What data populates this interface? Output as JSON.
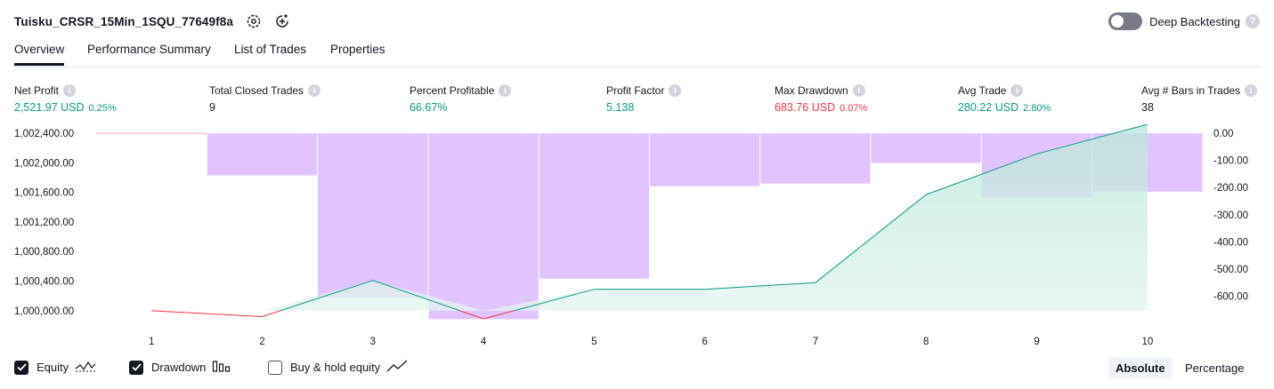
{
  "header": {
    "strategy_title": "Tuisku_CRSR_15Min_1SQU_77649f8a",
    "deep_backtesting_label": "Deep Backtesting"
  },
  "tabs": [
    {
      "label": "Overview",
      "active": true
    },
    {
      "label": "Performance Summary",
      "active": false
    },
    {
      "label": "List of Trades",
      "active": false
    },
    {
      "label": "Properties",
      "active": false
    }
  ],
  "metrics": [
    {
      "label": "Net Profit",
      "value": "2,521.97 USD",
      "sub": "0.25%",
      "color": "#089981"
    },
    {
      "label": "Total Closed Trades",
      "value": "9",
      "sub": "",
      "color": "#131722"
    },
    {
      "label": "Percent Profitable",
      "value": "66.67%",
      "sub": "",
      "color": "#089981"
    },
    {
      "label": "Profit Factor",
      "value": "5.138",
      "sub": "",
      "color": "#089981"
    },
    {
      "label": "Max Drawdown",
      "value": "683.76 USD",
      "sub": "0.07%",
      "color": "#f23645"
    },
    {
      "label": "Avg Trade",
      "value": "280.22 USD",
      "sub": "2.80%",
      "color": "#089981"
    },
    {
      "label": "Avg # Bars in Trades",
      "value": "38",
      "sub": "",
      "color": "#131722"
    }
  ],
  "legend": {
    "equity": {
      "label": "Equity",
      "checked": true
    },
    "drawdown": {
      "label": "Drawdown",
      "checked": true
    },
    "buy_hold": {
      "label": "Buy & hold equity",
      "checked": false
    }
  },
  "modes": {
    "absolute": "Absolute",
    "percentage": "Percentage",
    "active": "absolute"
  },
  "colors": {
    "profit": "#089981",
    "loss": "#f23645",
    "drawdown_bar": "#e1c4fd",
    "equity_area": "#e3f4ef",
    "text": "#131722"
  },
  "chart_data": {
    "type": "line",
    "x": [
      1,
      2,
      3,
      4,
      5,
      6,
      7,
      8,
      9,
      10
    ],
    "x_tick_labels": [
      "1",
      "2",
      "3",
      "4",
      "5",
      "6",
      "7",
      "8",
      "9",
      "10"
    ],
    "y_left_ticks": [
      "1,002,400.00",
      "1,002,000.00",
      "1,001,600.00",
      "1,001,200.00",
      "1,000,800.00",
      "1,000,400.00",
      "1,000,000.00"
    ],
    "y_left_tick_values": [
      1002400,
      1002000,
      1001600,
      1001200,
      1000800,
      1000400,
      1000000
    ],
    "y_left_range": [
      999890,
      1002400
    ],
    "y_right_ticks": [
      "0.00",
      "-100.00",
      "-200.00",
      "-300.00",
      "-400.00",
      "-500.00",
      "-600.00"
    ],
    "y_right_tick_values": [
      0,
      -100,
      -200,
      -300,
      -400,
      -500,
      -600
    ],
    "y_right_range": [
      -686,
      0
    ],
    "series": [
      {
        "name": "Equity",
        "axis": "left",
        "values": [
          1000000,
          999920,
          1000410,
          999890,
          1000290,
          1000290,
          1000380,
          1001570,
          1002120,
          1002520
        ]
      },
      {
        "name": "Drawdown",
        "axis": "right",
        "type": "bar",
        "values": [
          0,
          -155,
          -605,
          -684,
          -535,
          -195,
          -185,
          -110,
          -237,
          -215
        ]
      }
    ]
  }
}
